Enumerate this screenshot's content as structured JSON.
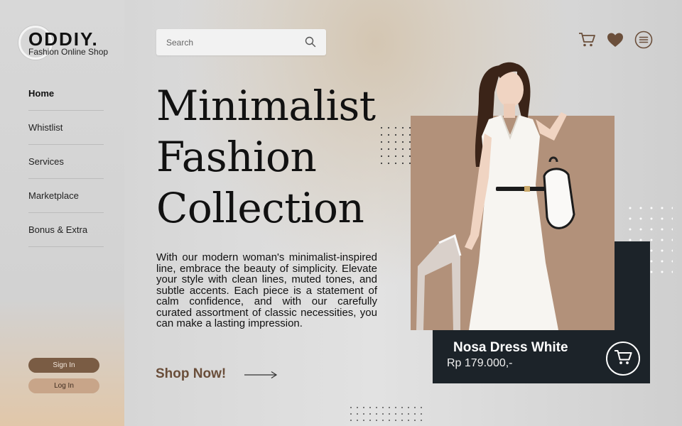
{
  "brand": {
    "name": "ODDIY.",
    "tagline": "Fashion Online Shop"
  },
  "nav": {
    "items": [
      "Home",
      "Whistlist",
      "Services",
      "Marketplace",
      "Bonus & Extra"
    ],
    "active": "Home"
  },
  "auth": {
    "sign_in": "Sign In",
    "log_in": "Log In"
  },
  "search": {
    "placeholder": "Search"
  },
  "header_icons": [
    "cart-icon",
    "heart-icon",
    "menu-icon"
  ],
  "hero": {
    "title_lines": [
      "Minimalist",
      "Fashion",
      "Collection"
    ],
    "description": "With our modern woman's minimalist-inspired line, embrace the beauty of simplicity. Elevate your style with clean lines, muted tones, and subtle accents. Each piece is a statement of calm confidence, and with our carefully curated assortment of classic necessities, you can make a lasting impression.",
    "cta": "Shop Now!"
  },
  "product": {
    "name": "Nosa Dress White",
    "price": "Rp 179.000,-"
  },
  "colors": {
    "accent_brown": "#7a5c44",
    "accent_tan": "#c8a589",
    "card_dark": "#1c2329",
    "photo_bg": "#b2917a"
  }
}
